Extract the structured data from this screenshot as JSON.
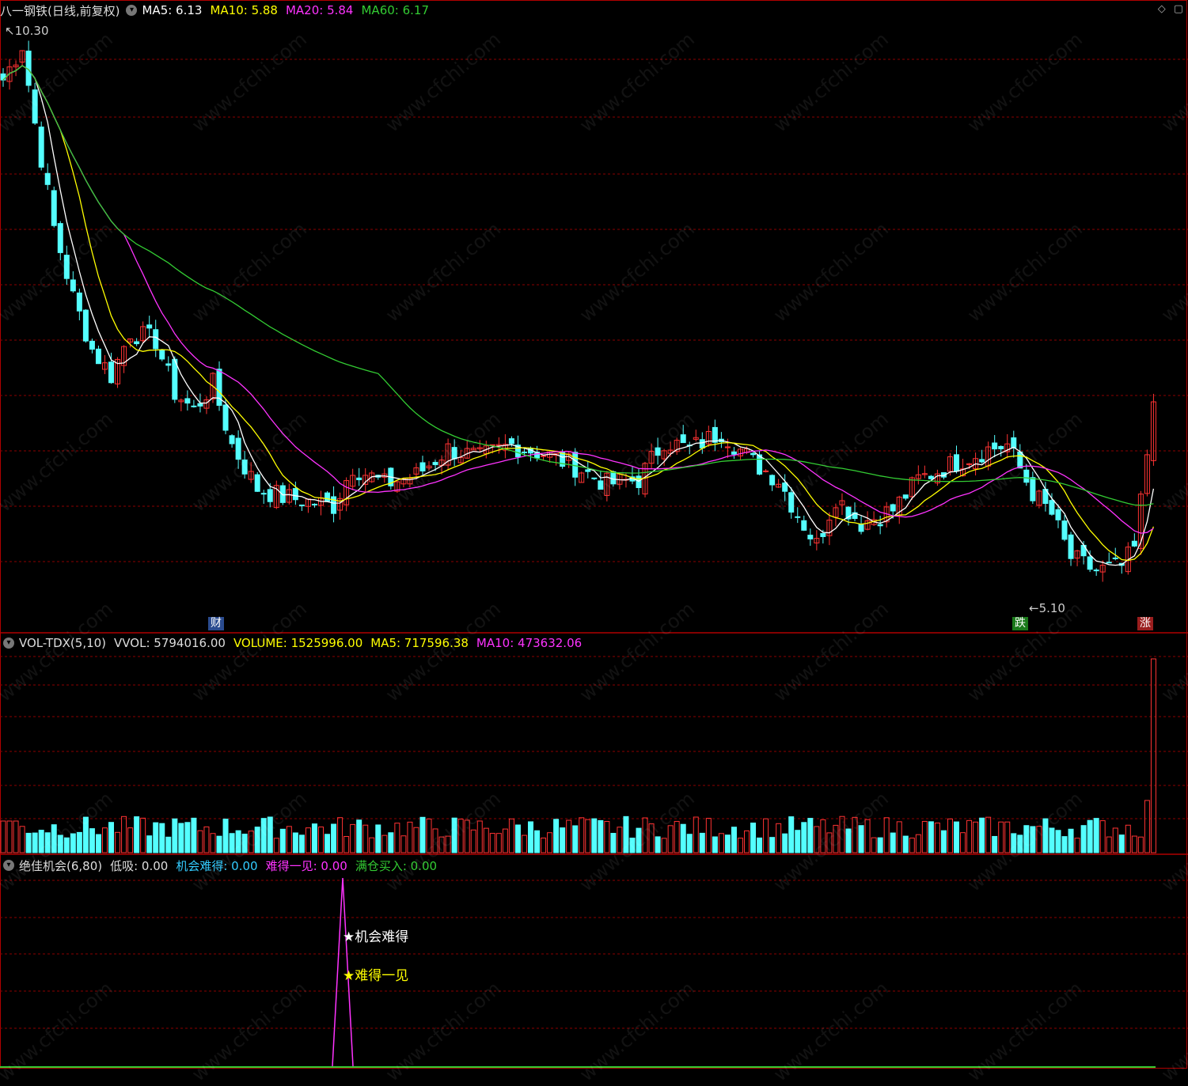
{
  "main_panel": {
    "title": "八一钢铁(日线,前复权)",
    "indicators": [
      {
        "label": "MA5: 6.13",
        "color": "#ffffff"
      },
      {
        "label": "MA10: 5.88",
        "color": "#ffff00"
      },
      {
        "label": "MA20: 5.84",
        "color": "#ff33ff"
      },
      {
        "label": "MA60: 6.17",
        "color": "#33cc33"
      }
    ],
    "high_mark": "10.30",
    "low_mark": "5.10",
    "badges": [
      {
        "text": "财",
        "bg": "#2a4b8f"
      },
      {
        "text": "跌",
        "bg": "#1a7a1a"
      },
      {
        "text": "涨",
        "bg": "#9a1e1e"
      }
    ],
    "icons": [
      "diamond-icon",
      "square-icon"
    ]
  },
  "volume_panel": {
    "title": "VOL-TDX(5,10)",
    "indicators": [
      {
        "label": "VVOL: 5794016.00",
        "color": "#dddddd"
      },
      {
        "label": "VOLUME: 1525996.00",
        "color": "#ffff00"
      },
      {
        "label": "MA5: 717596.38",
        "color": "#ffff00"
      },
      {
        "label": "MA10: 473632.06",
        "color": "#ff33ff"
      }
    ]
  },
  "signal_panel": {
    "title": "绝佳机会(6,80)",
    "indicators": [
      {
        "label": "低吸: 0.00",
        "color": "#dddddd"
      },
      {
        "label": "机会难得: 0.00",
        "color": "#33ccff"
      },
      {
        "label": "难得一见: 0.00",
        "color": "#ff33ff"
      },
      {
        "label": "满仓买入: 0.00",
        "color": "#33cc33"
      }
    ],
    "annotations": [
      {
        "text": "★机会难得",
        "color": "#ffffff"
      },
      {
        "text": "★难得一见",
        "color": "#ffff00"
      }
    ]
  },
  "watermark_text": "www.cfchi.com",
  "colors": {
    "up": "#ff3333",
    "down": "#54ffff",
    "ma5": "#ffffff",
    "ma10": "#ffff00",
    "ma20": "#ff33ff",
    "ma60": "#33cc33",
    "grid": "#8b0000",
    "border": "#b00000"
  }
}
